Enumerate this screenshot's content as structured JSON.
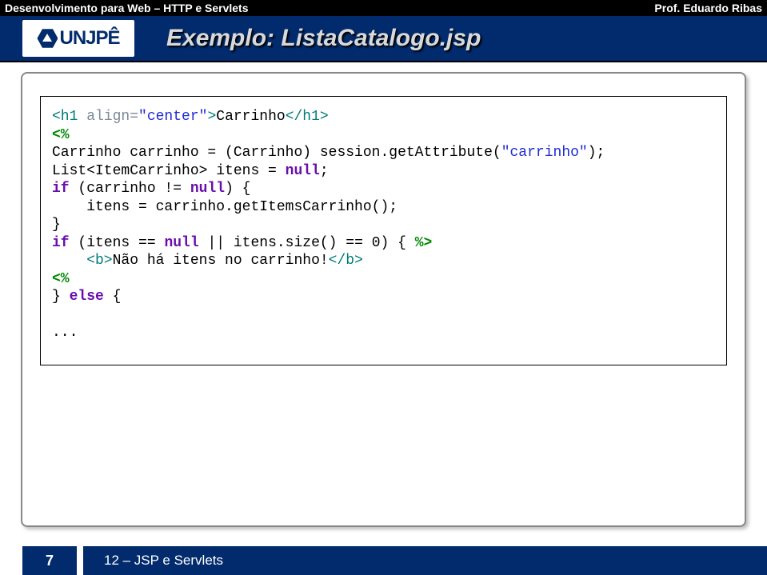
{
  "header": {
    "left": "Desenvolvimento para Web – HTTP e Servlets",
    "right": "Prof. Eduardo Ribas"
  },
  "logo": {
    "text": "UNJPÊ"
  },
  "title": "Exemplo: ListaCatalogo.jsp",
  "code": {
    "l1a": "<h1 ",
    "l1b": "align=",
    "l1c": "\"center\"",
    "l1d": ">",
    "l1e": "Carrinho",
    "l1f": "</h1>",
    "l2": "<%",
    "l3a": "Carrinho carrinho = (Carrinho) session.getAttribute(",
    "l3b": "\"carrinho\"",
    "l3c": ");",
    "l4a": "List<ItemCarrinho> itens = ",
    "l4b": "null",
    "l4c": ";",
    "l5a": "if",
    "l5b": " (carrinho != ",
    "l5c": "null",
    "l5d": ") {",
    "l6": "    itens = carrinho.getItemsCarrinho();",
    "l7": "}",
    "l8a": "if",
    "l8b": " (itens == ",
    "l8c": "null",
    "l8d": " || itens.size() == 0) { ",
    "l8e": "%>",
    "l9a": "    <b>",
    "l9b": "Não há itens no carrinho!",
    "l9c": "</b>",
    "l10": "<%",
    "l11a": "} ",
    "l11b": "else",
    "l11c": " {",
    "l12": "",
    "l13": "..."
  },
  "footer": {
    "page": "7",
    "text": "12 – JSP e Servlets"
  }
}
